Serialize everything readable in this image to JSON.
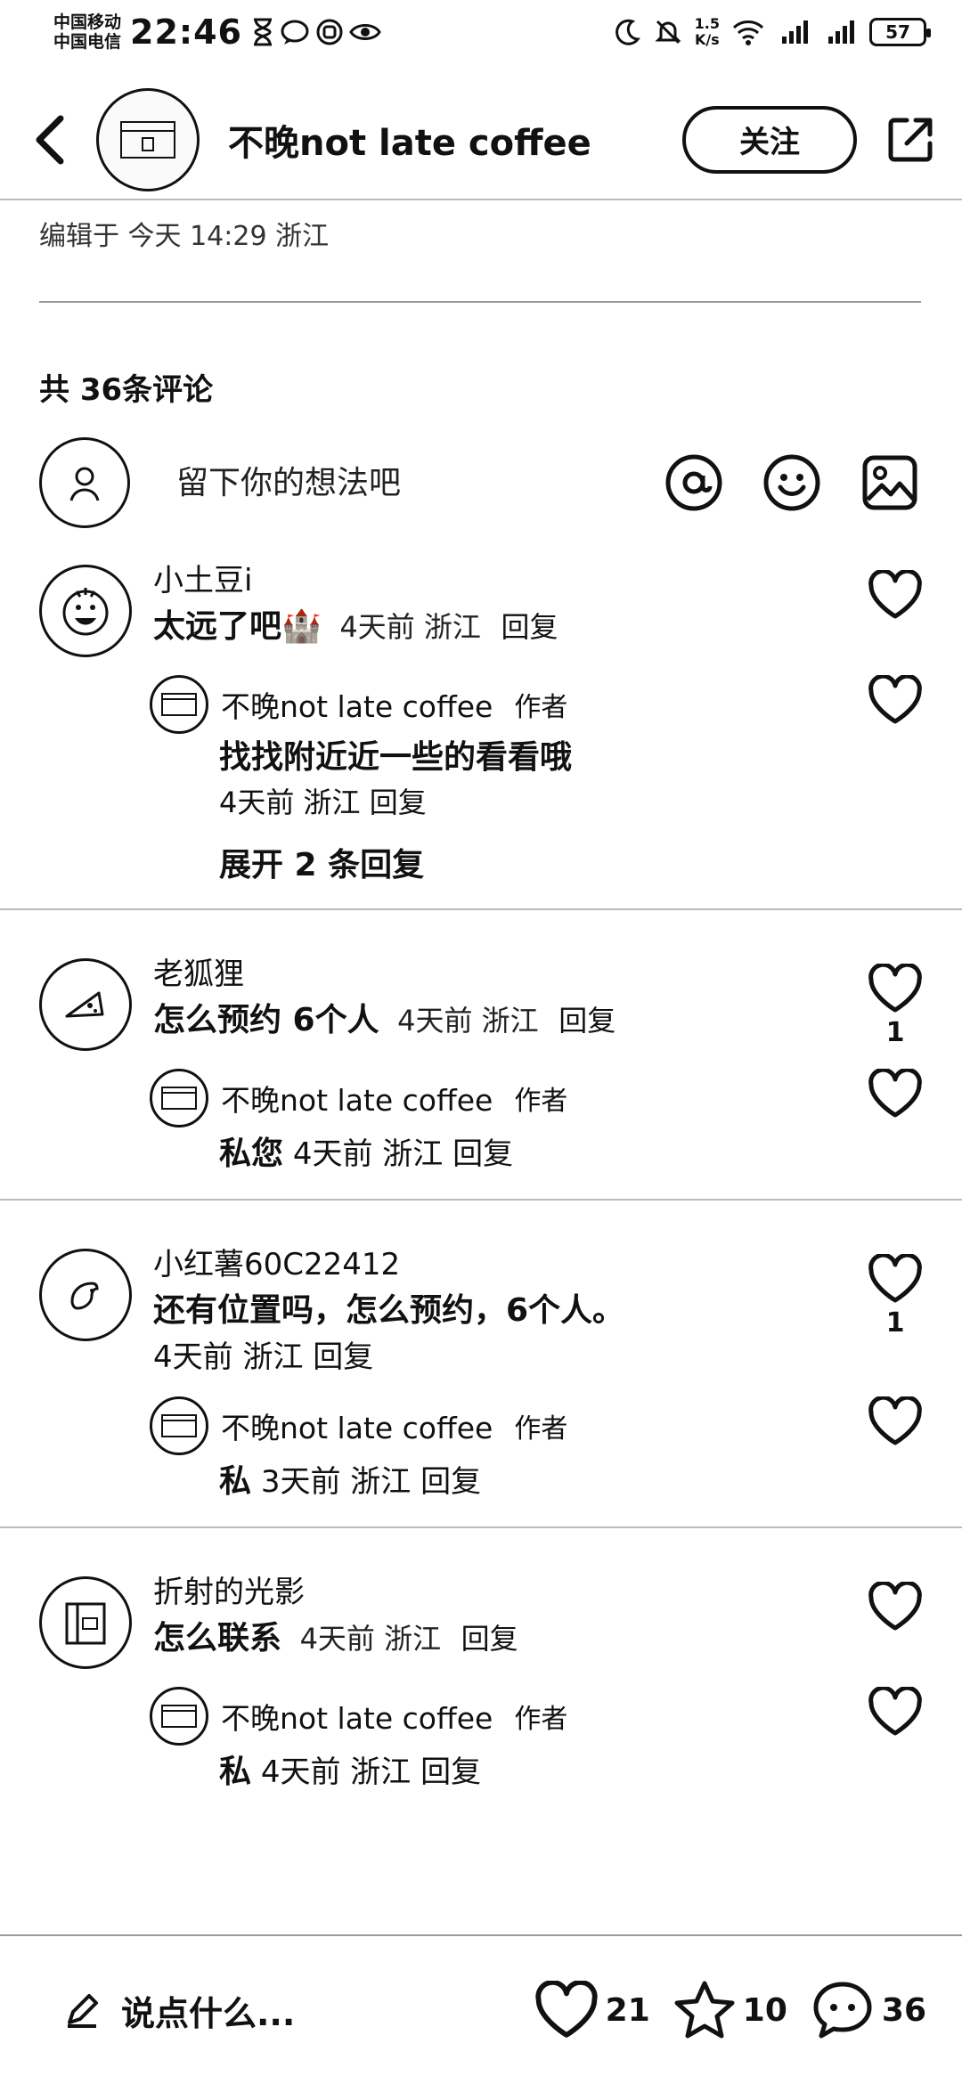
{
  "status_bar": {
    "carrier_1": "中国移动",
    "carrier_2": "中国电信",
    "time": "22:46",
    "net_speed_value": "1.5",
    "net_speed_unit": "K/s",
    "battery": "57"
  },
  "header": {
    "title": "不晚not late coffee",
    "follow_label": "关注"
  },
  "post": {
    "edited_info": "编辑于 今天 14:29 浙江"
  },
  "comments_section": {
    "count_label": "共 36条评论",
    "input_placeholder": "留下你的想法吧"
  },
  "threads": [
    {
      "user": "小土豆i",
      "text": "太远了吧",
      "emoji": "🏰",
      "meta": "4天前  浙江",
      "reply_label": "回复",
      "likes": "",
      "reply": {
        "user": "不晚not late coffee",
        "badge": "作者",
        "text": "找找附近近一些的看看哦",
        "meta": "4天前  浙江",
        "reply_label": "回复",
        "likes": ""
      },
      "expand_label": "展开 2 条回复"
    },
    {
      "user": "老狐狸",
      "text": "怎么预约 6个人",
      "meta": "4天前  浙江",
      "reply_label": "回复",
      "likes": "1",
      "reply": {
        "user": "不晚not late coffee",
        "badge": "作者",
        "text": "私您",
        "meta": "4天前  浙江",
        "reply_label": "回复",
        "likes": ""
      }
    },
    {
      "user": "小红薯60C22412",
      "text": "还有位置吗，怎么预约，6个人。",
      "meta": "4天前  浙江",
      "reply_label": "回复",
      "likes": "1",
      "reply": {
        "user": "不晚not late coffee",
        "badge": "作者",
        "text": "私",
        "meta": "3天前  浙江",
        "reply_label": "回复",
        "likes": ""
      }
    },
    {
      "user": "折射的光影",
      "text": "怎么联系",
      "meta": "4天前  浙江",
      "reply_label": "回复",
      "likes": "",
      "reply": {
        "user": "不晚not late coffee",
        "badge": "作者",
        "text": "私",
        "meta": "4天前  浙江",
        "reply_label": "回复",
        "likes": ""
      }
    }
  ],
  "bottom_bar": {
    "say_placeholder": "说点什么...",
    "likes": "21",
    "favorites": "10",
    "comments": "36"
  },
  "icons": {
    "back": "chevron-left-icon",
    "share": "share-icon",
    "at": "at-icon",
    "emoji": "emoji-icon",
    "image": "image-icon",
    "heart": "heart-icon",
    "star": "star-icon",
    "comment": "comment-bubble-icon",
    "pen": "pen-icon"
  }
}
